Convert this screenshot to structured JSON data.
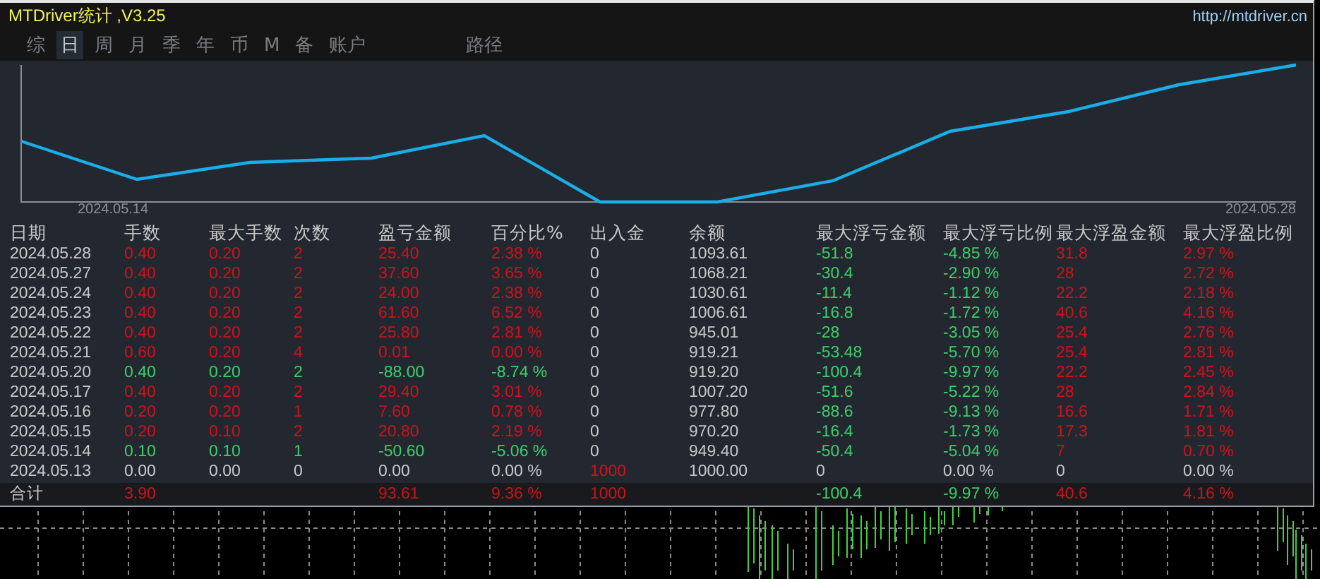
{
  "window": {
    "title": "MTDriver统计 ,V3.25",
    "link": "http://mtdriver.cn"
  },
  "tabs": [
    {
      "label": "综",
      "selected": false
    },
    {
      "label": "日",
      "selected": true
    },
    {
      "label": "周",
      "selected": false
    },
    {
      "label": "月",
      "selected": false
    },
    {
      "label": "季",
      "selected": false
    },
    {
      "label": "年",
      "selected": false
    },
    {
      "label": "币",
      "selected": false
    },
    {
      "label": "M",
      "selected": false
    },
    {
      "label": "备",
      "selected": false
    },
    {
      "label": "账户",
      "selected": false
    },
    {
      "label": "路径",
      "selected": false,
      "kind": "far"
    }
  ],
  "equity_chart": {
    "start_label": "2024.05.14",
    "end_label": "2024.05.28"
  },
  "table": {
    "columns": [
      "日期",
      "手数",
      "最大手数",
      "次数",
      "盈亏金额",
      "百分比%",
      "出入金",
      "余额",
      "最大浮亏金额",
      "最大浮亏比例",
      "最大浮盈金额",
      "最大浮盈比例"
    ],
    "rows": [
      {
        "cells": [
          {
            "text": "2024.05.28",
            "color": "#c8c8c8"
          },
          {
            "text": "0.40",
            "color": "#d0121b"
          },
          {
            "text": "0.20",
            "color": "#d0121b"
          },
          {
            "text": "2",
            "color": "#d0121b"
          },
          {
            "text": "25.40",
            "color": "#d0121b"
          },
          {
            "text": "2.38 %",
            "color": "#d0121b"
          },
          {
            "text": "0",
            "color": "#c8c8c8"
          },
          {
            "text": "1093.61",
            "color": "#c8c8c8"
          },
          {
            "text": "-51.8",
            "color": "#3ccf6a"
          },
          {
            "text": "-4.85 %",
            "color": "#3ccf6a"
          },
          {
            "text": "31.8",
            "color": "#d0121b"
          },
          {
            "text": "2.97 %",
            "color": "#d0121b"
          }
        ]
      },
      {
        "cells": [
          {
            "text": "2024.05.27",
            "color": "#c8c8c8"
          },
          {
            "text": "0.40",
            "color": "#d0121b"
          },
          {
            "text": "0.20",
            "color": "#d0121b"
          },
          {
            "text": "2",
            "color": "#d0121b"
          },
          {
            "text": "37.60",
            "color": "#d0121b"
          },
          {
            "text": "3.65 %",
            "color": "#d0121b"
          },
          {
            "text": "0",
            "color": "#c8c8c8"
          },
          {
            "text": "1068.21",
            "color": "#c8c8c8"
          },
          {
            "text": "-30.4",
            "color": "#3ccf6a"
          },
          {
            "text": "-2.90 %",
            "color": "#3ccf6a"
          },
          {
            "text": "28",
            "color": "#d0121b"
          },
          {
            "text": "2.72 %",
            "color": "#d0121b"
          }
        ]
      },
      {
        "cells": [
          {
            "text": "2024.05.24",
            "color": "#c8c8c8"
          },
          {
            "text": "0.40",
            "color": "#d0121b"
          },
          {
            "text": "0.20",
            "color": "#d0121b"
          },
          {
            "text": "2",
            "color": "#d0121b"
          },
          {
            "text": "24.00",
            "color": "#d0121b"
          },
          {
            "text": "2.38 %",
            "color": "#d0121b"
          },
          {
            "text": "0",
            "color": "#c8c8c8"
          },
          {
            "text": "1030.61",
            "color": "#c8c8c8"
          },
          {
            "text": "-11.4",
            "color": "#3ccf6a"
          },
          {
            "text": "-1.12 %",
            "color": "#3ccf6a"
          },
          {
            "text": "22.2",
            "color": "#d0121b"
          },
          {
            "text": "2.18 %",
            "color": "#d0121b"
          }
        ]
      },
      {
        "cells": [
          {
            "text": "2024.05.23",
            "color": "#c8c8c8"
          },
          {
            "text": "0.40",
            "color": "#d0121b"
          },
          {
            "text": "0.20",
            "color": "#d0121b"
          },
          {
            "text": "2",
            "color": "#d0121b"
          },
          {
            "text": "61.60",
            "color": "#d0121b"
          },
          {
            "text": "6.52 %",
            "color": "#d0121b"
          },
          {
            "text": "0",
            "color": "#c8c8c8"
          },
          {
            "text": "1006.61",
            "color": "#c8c8c8"
          },
          {
            "text": "-16.8",
            "color": "#3ccf6a"
          },
          {
            "text": "-1.72 %",
            "color": "#3ccf6a"
          },
          {
            "text": "40.6",
            "color": "#d0121b"
          },
          {
            "text": "4.16 %",
            "color": "#d0121b"
          }
        ]
      },
      {
        "cells": [
          {
            "text": "2024.05.22",
            "color": "#c8c8c8"
          },
          {
            "text": "0.40",
            "color": "#d0121b"
          },
          {
            "text": "0.20",
            "color": "#d0121b"
          },
          {
            "text": "2",
            "color": "#d0121b"
          },
          {
            "text": "25.80",
            "color": "#d0121b"
          },
          {
            "text": "2.81 %",
            "color": "#d0121b"
          },
          {
            "text": "0",
            "color": "#c8c8c8"
          },
          {
            "text": "945.01",
            "color": "#c8c8c8"
          },
          {
            "text": "-28",
            "color": "#3ccf6a"
          },
          {
            "text": "-3.05 %",
            "color": "#3ccf6a"
          },
          {
            "text": "25.4",
            "color": "#d0121b"
          },
          {
            "text": "2.76 %",
            "color": "#d0121b"
          }
        ]
      },
      {
        "cells": [
          {
            "text": "2024.05.21",
            "color": "#c8c8c8"
          },
          {
            "text": "0.60",
            "color": "#d0121b"
          },
          {
            "text": "0.20",
            "color": "#d0121b"
          },
          {
            "text": "4",
            "color": "#d0121b"
          },
          {
            "text": "0.01",
            "color": "#d0121b"
          },
          {
            "text": "0.00 %",
            "color": "#d0121b"
          },
          {
            "text": "0",
            "color": "#c8c8c8"
          },
          {
            "text": "919.21",
            "color": "#c8c8c8"
          },
          {
            "text": "-53.48",
            "color": "#3ccf6a"
          },
          {
            "text": "-5.70 %",
            "color": "#3ccf6a"
          },
          {
            "text": "25.4",
            "color": "#d0121b"
          },
          {
            "text": "2.81 %",
            "color": "#d0121b"
          }
        ]
      },
      {
        "cells": [
          {
            "text": "2024.05.20",
            "color": "#c8c8c8"
          },
          {
            "text": "0.40",
            "color": "#3ccf6a"
          },
          {
            "text": "0.20",
            "color": "#3ccf6a"
          },
          {
            "text": "2",
            "color": "#3ccf6a"
          },
          {
            "text": "-88.00",
            "color": "#3ccf6a"
          },
          {
            "text": "-8.74 %",
            "color": "#3ccf6a"
          },
          {
            "text": "0",
            "color": "#c8c8c8"
          },
          {
            "text": "919.20",
            "color": "#c8c8c8"
          },
          {
            "text": "-100.4",
            "color": "#3ccf6a"
          },
          {
            "text": "-9.97 %",
            "color": "#3ccf6a"
          },
          {
            "text": "22.2",
            "color": "#d0121b"
          },
          {
            "text": "2.45 %",
            "color": "#d0121b"
          }
        ]
      },
      {
        "cells": [
          {
            "text": "2024.05.17",
            "color": "#c8c8c8"
          },
          {
            "text": "0.40",
            "color": "#d0121b"
          },
          {
            "text": "0.20",
            "color": "#d0121b"
          },
          {
            "text": "2",
            "color": "#d0121b"
          },
          {
            "text": "29.40",
            "color": "#d0121b"
          },
          {
            "text": "3.01 %",
            "color": "#d0121b"
          },
          {
            "text": "0",
            "color": "#c8c8c8"
          },
          {
            "text": "1007.20",
            "color": "#c8c8c8"
          },
          {
            "text": "-51.6",
            "color": "#3ccf6a"
          },
          {
            "text": "-5.22 %",
            "color": "#3ccf6a"
          },
          {
            "text": "28",
            "color": "#d0121b"
          },
          {
            "text": "2.84 %",
            "color": "#d0121b"
          }
        ]
      },
      {
        "cells": [
          {
            "text": "2024.05.16",
            "color": "#c8c8c8"
          },
          {
            "text": "0.20",
            "color": "#d0121b"
          },
          {
            "text": "0.20",
            "color": "#d0121b"
          },
          {
            "text": "1",
            "color": "#d0121b"
          },
          {
            "text": "7.60",
            "color": "#d0121b"
          },
          {
            "text": "0.78 %",
            "color": "#d0121b"
          },
          {
            "text": "0",
            "color": "#c8c8c8"
          },
          {
            "text": "977.80",
            "color": "#c8c8c8"
          },
          {
            "text": "-88.6",
            "color": "#3ccf6a"
          },
          {
            "text": "-9.13 %",
            "color": "#3ccf6a"
          },
          {
            "text": "16.6",
            "color": "#d0121b"
          },
          {
            "text": "1.71 %",
            "color": "#d0121b"
          }
        ]
      },
      {
        "cells": [
          {
            "text": "2024.05.15",
            "color": "#c8c8c8"
          },
          {
            "text": "0.20",
            "color": "#d0121b"
          },
          {
            "text": "0.10",
            "color": "#d0121b"
          },
          {
            "text": "2",
            "color": "#d0121b"
          },
          {
            "text": "20.80",
            "color": "#d0121b"
          },
          {
            "text": "2.19 %",
            "color": "#d0121b"
          },
          {
            "text": "0",
            "color": "#c8c8c8"
          },
          {
            "text": "970.20",
            "color": "#c8c8c8"
          },
          {
            "text": "-16.4",
            "color": "#3ccf6a"
          },
          {
            "text": "-1.73 %",
            "color": "#3ccf6a"
          },
          {
            "text": "17.3",
            "color": "#d0121b"
          },
          {
            "text": "1.81 %",
            "color": "#d0121b"
          }
        ]
      },
      {
        "cells": [
          {
            "text": "2024.05.14",
            "color": "#c8c8c8"
          },
          {
            "text": "0.10",
            "color": "#3ccf6a"
          },
          {
            "text": "0.10",
            "color": "#3ccf6a"
          },
          {
            "text": "1",
            "color": "#3ccf6a"
          },
          {
            "text": "-50.60",
            "color": "#3ccf6a"
          },
          {
            "text": "-5.06 %",
            "color": "#3ccf6a"
          },
          {
            "text": "0",
            "color": "#c8c8c8"
          },
          {
            "text": "949.40",
            "color": "#c8c8c8"
          },
          {
            "text": "-50.4",
            "color": "#3ccf6a"
          },
          {
            "text": "-5.04 %",
            "color": "#3ccf6a"
          },
          {
            "text": "7",
            "color": "#d0121b"
          },
          {
            "text": "0.70 %",
            "color": "#d0121b"
          }
        ]
      },
      {
        "cells": [
          {
            "text": "2024.05.13",
            "color": "#c8c8c8"
          },
          {
            "text": "0.00",
            "color": "#c8c8c8"
          },
          {
            "text": "0.00",
            "color": "#c8c8c8"
          },
          {
            "text": "0",
            "color": "#c8c8c8"
          },
          {
            "text": "0.00",
            "color": "#c8c8c8"
          },
          {
            "text": "0.00 %",
            "color": "#c8c8c8"
          },
          {
            "text": "1000",
            "color": "#d0121b"
          },
          {
            "text": "1000.00",
            "color": "#c8c8c8"
          },
          {
            "text": "0",
            "color": "#c8c8c8"
          },
          {
            "text": "0.00 %",
            "color": "#c8c8c8"
          },
          {
            "text": "0",
            "color": "#c8c8c8"
          },
          {
            "text": "0.00 %",
            "color": "#c8c8c8"
          }
        ]
      }
    ],
    "total": {
      "cells": [
        {
          "text": "合计",
          "color": "#c8c8c8"
        },
        {
          "text": "3.90",
          "color": "#d0121b"
        },
        null,
        null,
        {
          "text": "93.61",
          "color": "#d0121b"
        },
        {
          "text": "9.36 %",
          "color": "#d0121b"
        },
        {
          "text": "1000",
          "color": "#d0121b"
        },
        null,
        {
          "text": "-100.4",
          "color": "#3ccf6a"
        },
        {
          "text": "-9.97 %",
          "color": "#3ccf6a"
        },
        {
          "text": "40.6",
          "color": "#d0121b"
        },
        {
          "text": "4.16 %",
          "color": "#d0121b"
        }
      ]
    }
  }
}
